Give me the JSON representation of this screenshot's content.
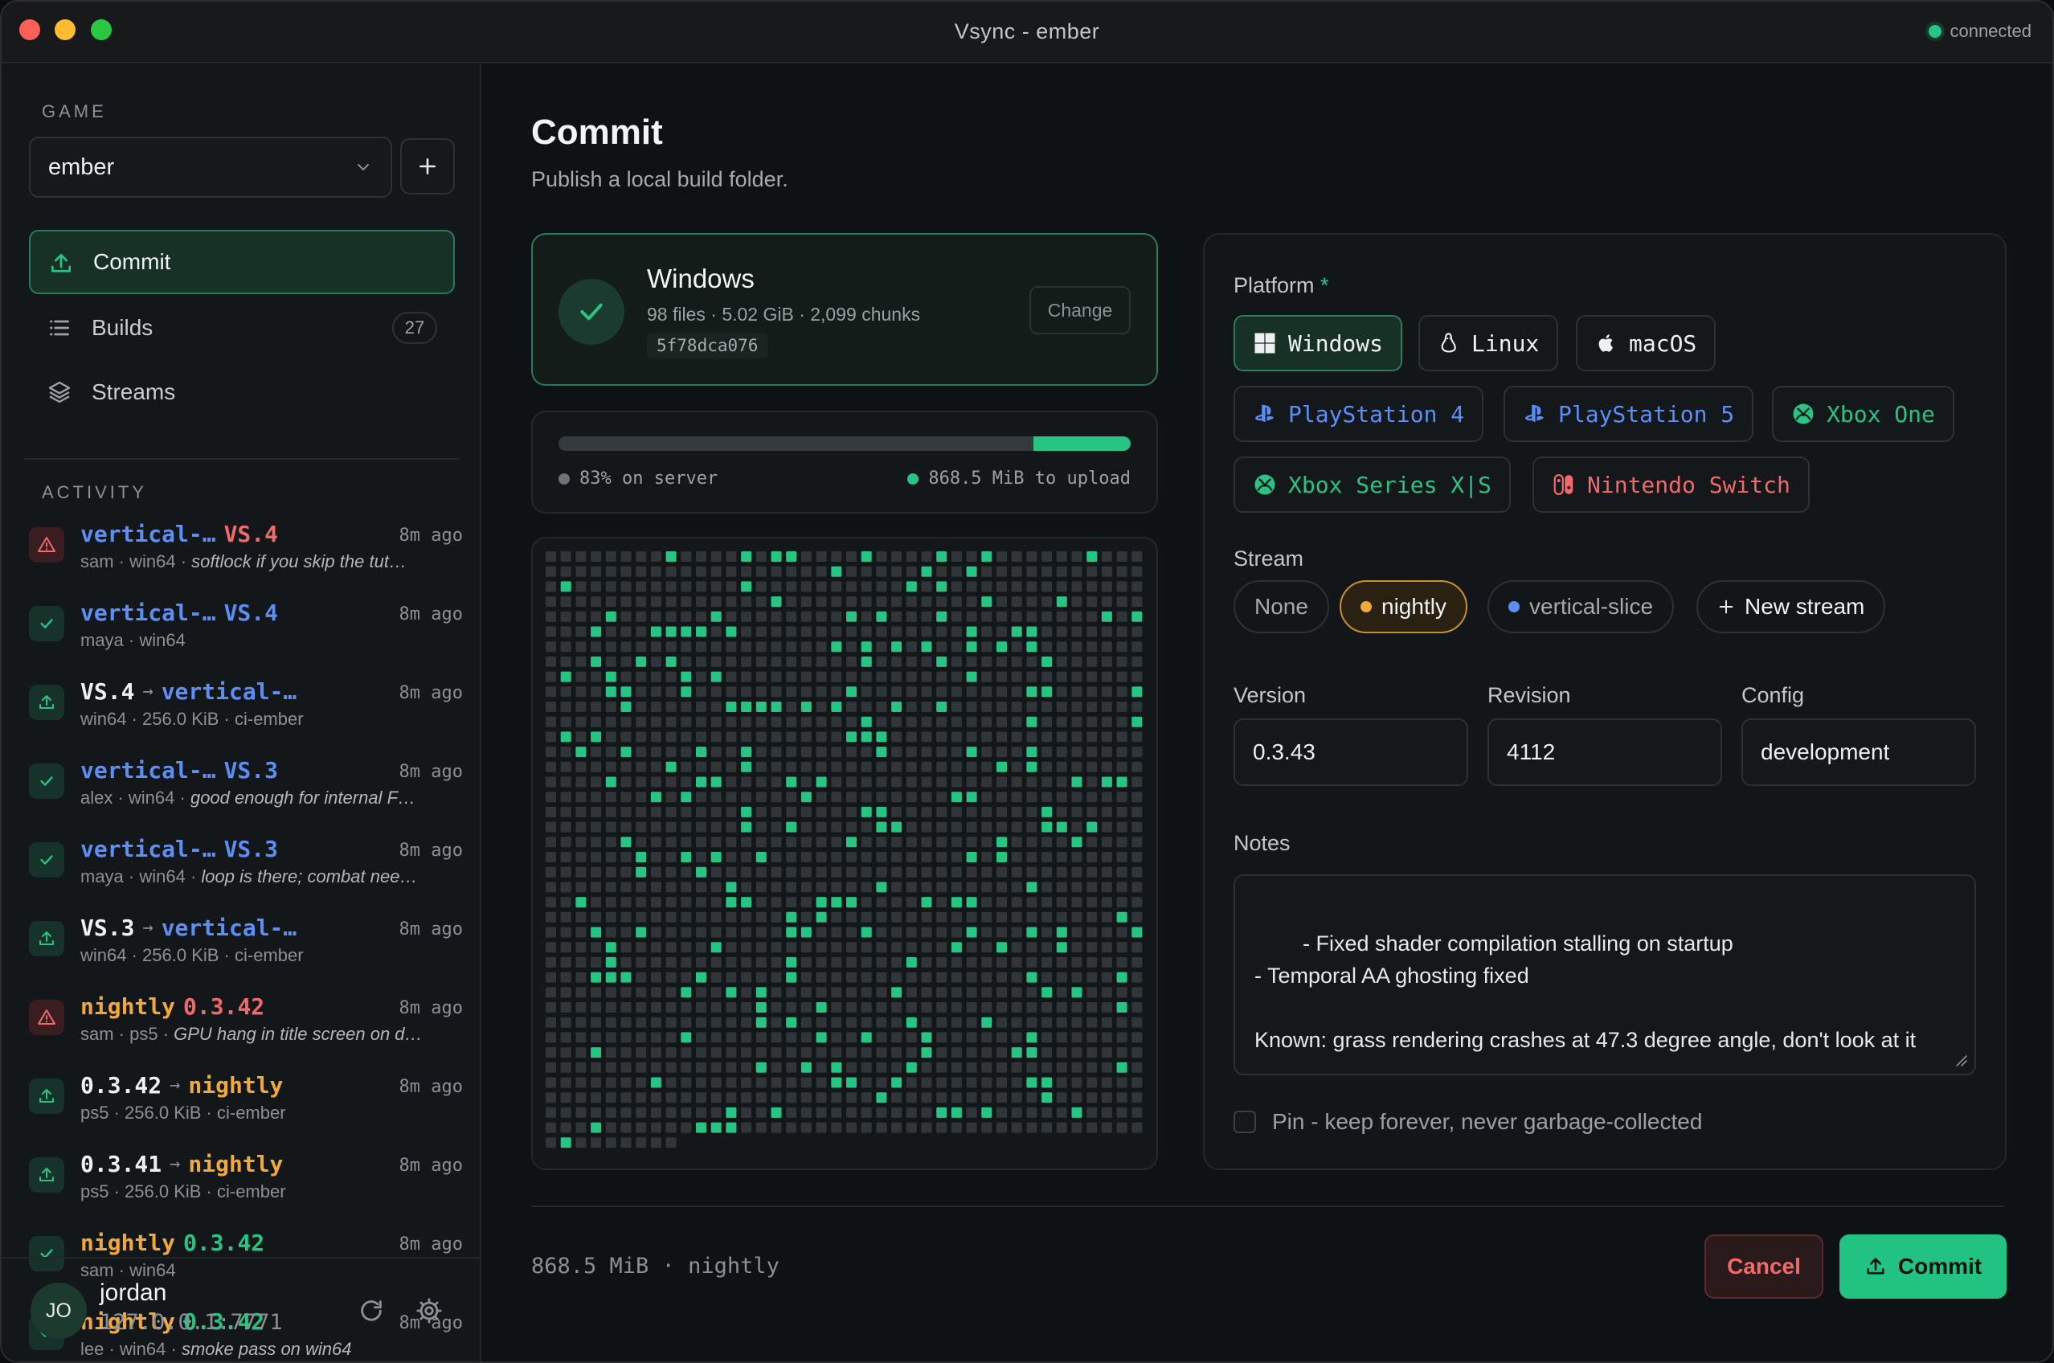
{
  "window": {
    "title": "Vsync - ember",
    "connection": "connected"
  },
  "sidebar": {
    "game_label": "GAME",
    "game_value": "ember",
    "nav": [
      {
        "label": "Commit",
        "icon": "upload-icon",
        "active": true
      },
      {
        "label": "Builds",
        "icon": "list-icon",
        "badge": "27"
      },
      {
        "label": "Streams",
        "icon": "layers-icon"
      }
    ],
    "activity_label": "ACTIVITY",
    "activity": [
      {
        "status": "error",
        "a": "vertical-…",
        "a_color": "blue",
        "b": "VS.4",
        "b_color": "red",
        "arrow": false,
        "ago": "8m ago",
        "meta": "sam · win64 · ",
        "note": "softlock if you skip the tut…"
      },
      {
        "status": "ok",
        "a": "vertical-…",
        "a_color": "blue",
        "b": "VS.4",
        "b_color": "blue",
        "arrow": false,
        "ago": "8m ago",
        "meta": "maya · win64",
        "note": ""
      },
      {
        "status": "upload",
        "a": "VS.4",
        "a_color": "white",
        "b": "vertical-…",
        "b_color": "blue",
        "arrow": true,
        "ago": "8m ago",
        "meta": "win64 · 256.0 KiB · ci-ember",
        "note": ""
      },
      {
        "status": "ok",
        "a": "vertical-…",
        "a_color": "blue",
        "b": "VS.3",
        "b_color": "blue",
        "arrow": false,
        "ago": "8m ago",
        "meta": "alex · win64 · ",
        "note": "good enough for internal F…"
      },
      {
        "status": "ok",
        "a": "vertical-…",
        "a_color": "blue",
        "b": "VS.3",
        "b_color": "blue",
        "arrow": false,
        "ago": "8m ago",
        "meta": "maya · win64 · ",
        "note": "loop is there; combat nee…"
      },
      {
        "status": "upload",
        "a": "VS.3",
        "a_color": "white",
        "b": "vertical-…",
        "b_color": "blue",
        "arrow": true,
        "ago": "8m ago",
        "meta": "win64 · 256.0 KiB · ci-ember",
        "note": ""
      },
      {
        "status": "error",
        "a": "nightly",
        "a_color": "orange",
        "b": "0.3.42",
        "b_color": "red",
        "arrow": false,
        "ago": "8m ago",
        "meta": "sam · ps5 · ",
        "note": "GPU hang in title screen on d…"
      },
      {
        "status": "upload",
        "a": "0.3.42",
        "a_color": "white",
        "b": "nightly",
        "b_color": "orange",
        "arrow": true,
        "ago": "8m ago",
        "meta": "ps5 · 256.0 KiB · ci-ember",
        "note": ""
      },
      {
        "status": "upload",
        "a": "0.3.41",
        "a_color": "white",
        "b": "nightly",
        "b_color": "orange",
        "arrow": true,
        "ago": "8m ago",
        "meta": "ps5 · 256.0 KiB · ci-ember",
        "note": ""
      },
      {
        "status": "ok",
        "a": "nightly",
        "a_color": "orange",
        "b": "0.3.42",
        "b_color": "green",
        "arrow": false,
        "ago": "8m ago",
        "meta": "sam · win64",
        "note": ""
      },
      {
        "status": "ok",
        "a": "nightly",
        "a_color": "orange",
        "b": "0.3.42",
        "b_color": "green",
        "arrow": false,
        "ago": "8m ago",
        "meta": "lee · win64 · ",
        "note": "smoke pass on win64"
      }
    ],
    "user": {
      "initials": "JO",
      "name": "jordan",
      "address": "127.0.0.1:7771"
    }
  },
  "main": {
    "title": "Commit",
    "subtitle": "Publish a local build folder.",
    "build": {
      "platform": "Windows",
      "meta": "98 files · 5.02 GiB · 2,099 chunks",
      "hash": "5f78dca076",
      "change_label": "Change"
    },
    "progress": {
      "server_fraction": 0.83,
      "left_label": "83% on server",
      "right_label": "868.5 MiB to upload"
    },
    "chunks": {
      "cols": 40,
      "rows": 40,
      "total": 2099
    },
    "form": {
      "platform_label": "Platform",
      "platform_required": "*",
      "platforms": [
        {
          "label": "Windows",
          "icon": "windows-icon",
          "selected": true,
          "color": "#eef0f2"
        },
        {
          "label": "Linux",
          "icon": "linux-icon",
          "color": "#eef0f2"
        },
        {
          "label": "macOS",
          "icon": "apple-icon",
          "color": "#eef0f2"
        },
        {
          "label": "PlayStation 4",
          "icon": "playstation-icon",
          "color": "#5b8ef7"
        },
        {
          "label": "PlayStation 5",
          "icon": "playstation-icon",
          "color": "#5b8ef7"
        },
        {
          "label": "Xbox One",
          "icon": "xbox-icon",
          "color": "#27c483"
        },
        {
          "label": "Xbox Series X|S",
          "icon": "xbox-icon",
          "color": "#27c483"
        },
        {
          "label": "Nintendo Switch",
          "icon": "switch-icon",
          "color": "#f06a6a"
        }
      ],
      "stream_label": "Stream",
      "streams": [
        {
          "label": "None"
        },
        {
          "label": "nightly",
          "selected": true,
          "dot": "#f1a93c"
        },
        {
          "label": "vertical-slice",
          "dot": "#5b8ef7"
        },
        {
          "label": "New stream",
          "icon": "plus-icon"
        }
      ],
      "version_label": "Version",
      "version": "0.3.43",
      "revision_label": "Revision",
      "revision": "4112",
      "config_label": "Config",
      "config": "development",
      "notes_label": "Notes",
      "notes": "- Fixed shader compilation stalling on startup\n- Temporal AA ghosting fixed\n\nKnown: grass rendering crashes at 47.3 degree angle, don't look at it",
      "pin_label": "Pin - keep forever, never garbage-collected"
    },
    "footer": {
      "status": "868.5 MiB · nightly",
      "cancel": "Cancel",
      "commit": "Commit"
    }
  },
  "colors": {
    "accent": "#27c483",
    "blue": "#5b8ef7",
    "red": "#f06a6a",
    "orange": "#f1a93c"
  }
}
